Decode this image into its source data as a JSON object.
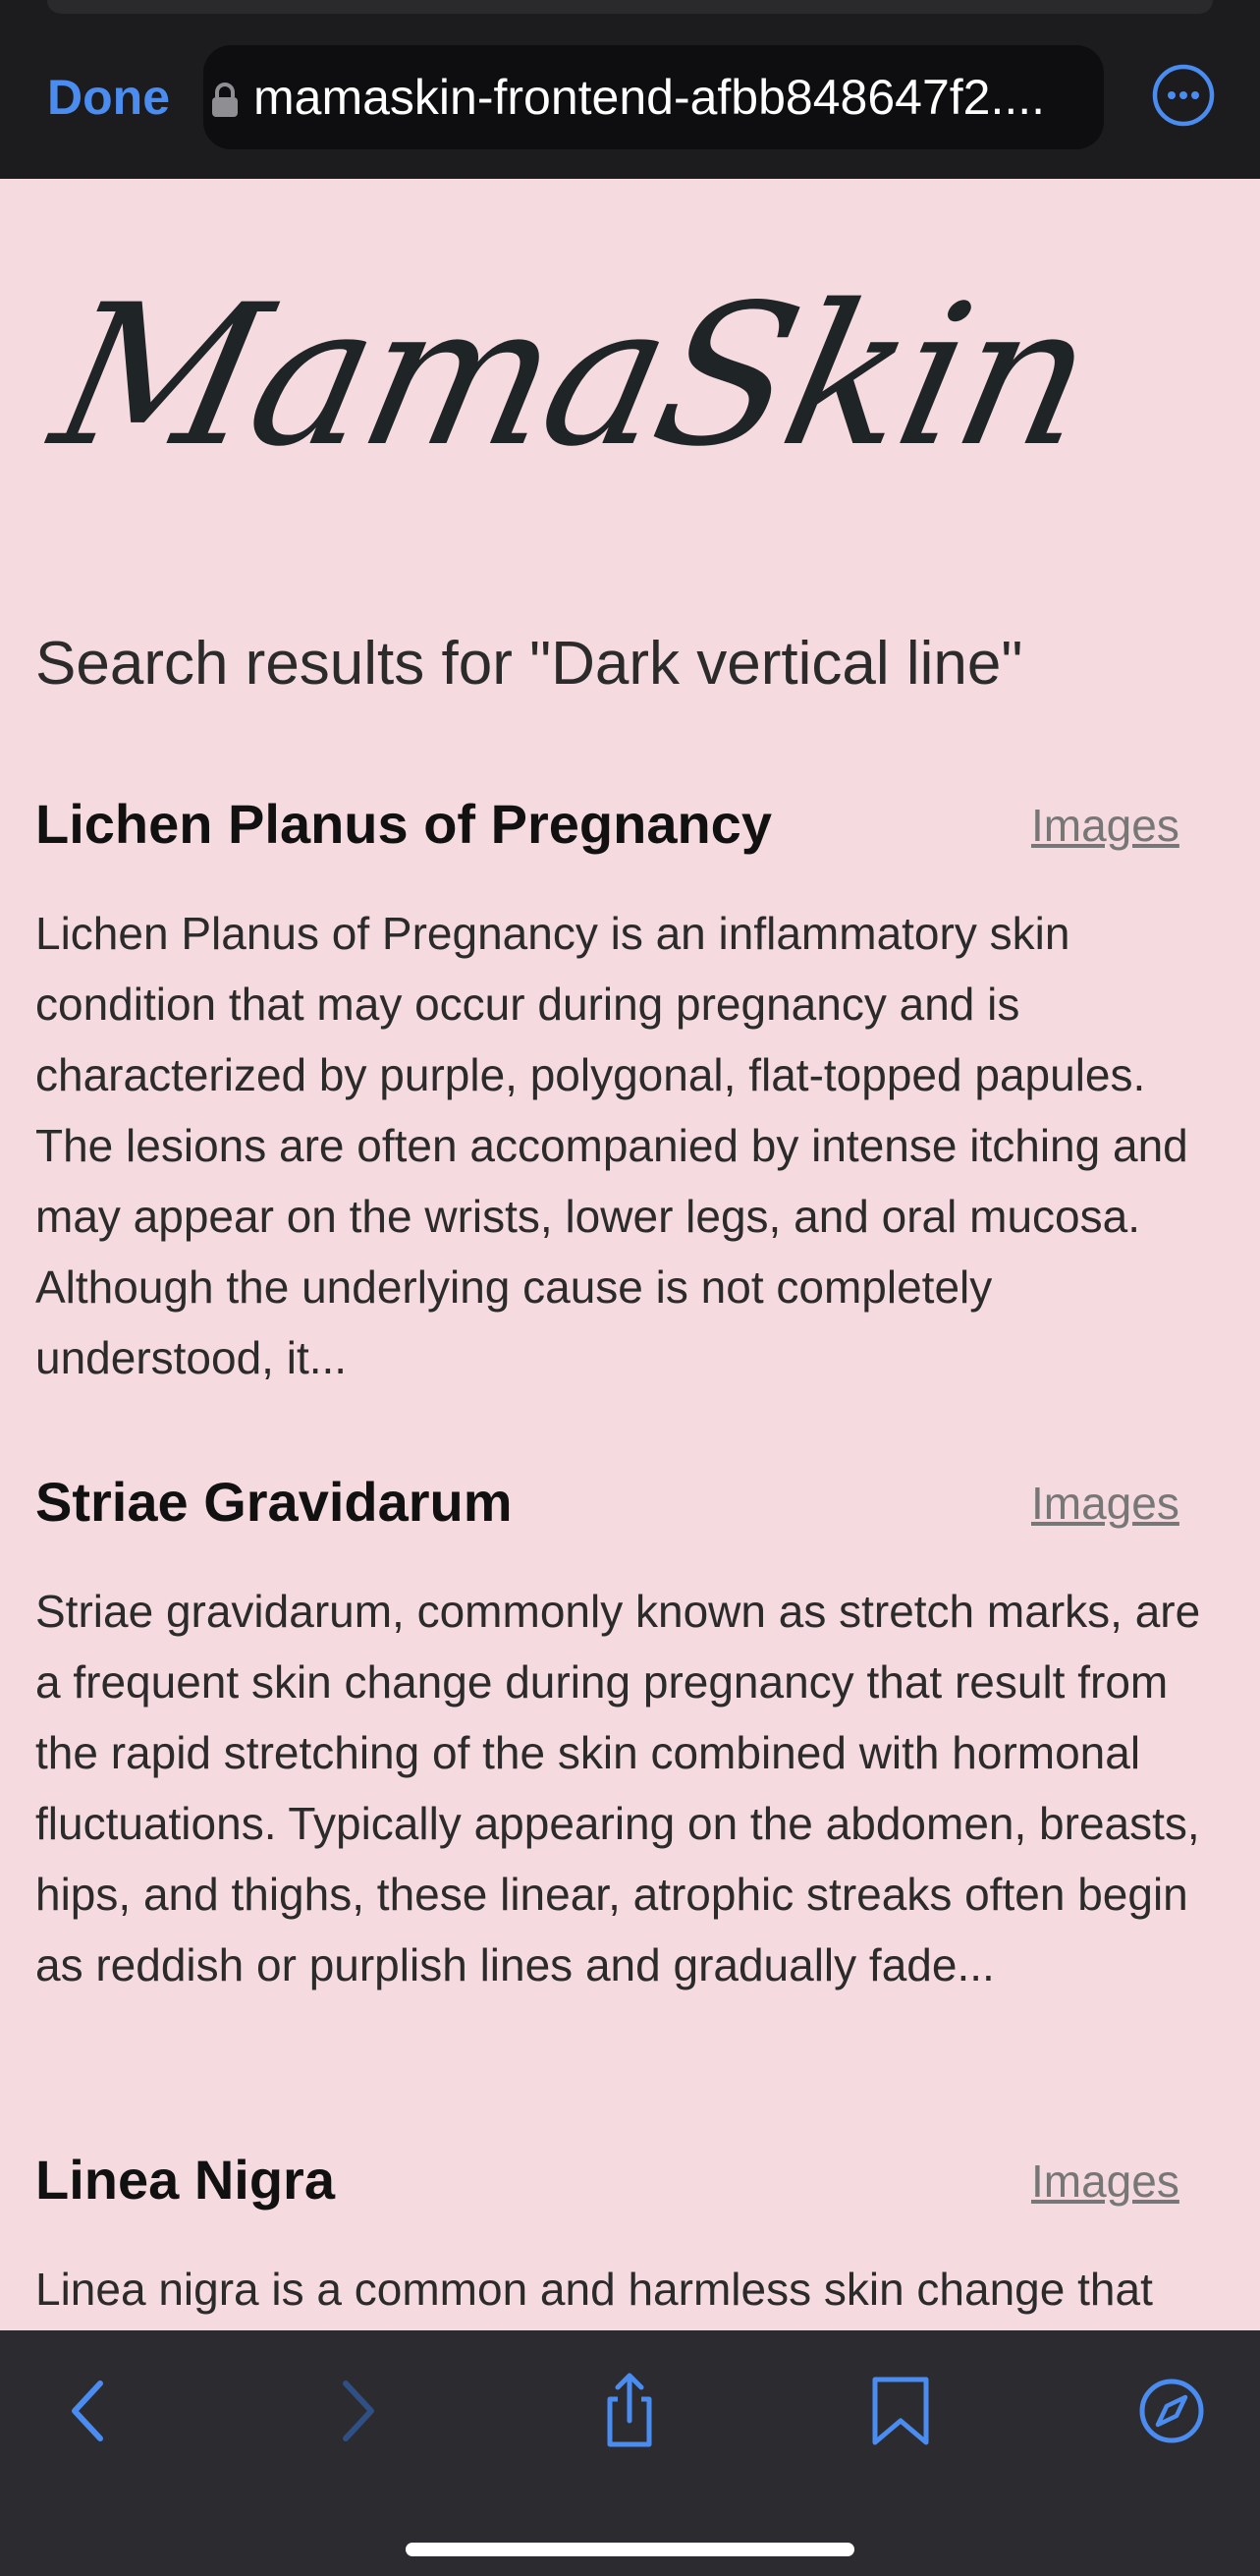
{
  "browser": {
    "done_label": "Done",
    "url": "mamaskin-frontend-afbb848647f2....",
    "icons": {
      "lock": "lock-icon",
      "more": "more-options-icon",
      "back": "chevron-left-icon",
      "forward": "chevron-right-icon",
      "share": "share-icon",
      "bookmarks": "bookmark-icon",
      "tabs": "compass-icon"
    },
    "accent_color": "#4a8cf0"
  },
  "page": {
    "logo": "MamaSkin",
    "search_heading": "Search results for \"Dark vertical line\"",
    "background_color": "#f5dadf",
    "results": [
      {
        "title": "Lichen Planus of Pregnancy",
        "images_label": "Images",
        "description": "Lichen Planus of Pregnancy is an inflammatory skin condition that may occur during pregnancy and is characterized by purple, polygonal, flat-topped papules. The lesions are often accompanied by intense itching and may appear on the wrists, lower legs, and oral mucosa. Although the underlying cause is not completely understood, it..."
      },
      {
        "title": "Striae Gravidarum",
        "images_label": "Images",
        "description": "Striae gravidarum, commonly known as stretch marks, are a frequent skin change during pregnancy that result from the rapid stretching of the skin combined with hormonal fluctuations. Typically appearing on the abdomen, breasts, hips, and thighs, these linear, atrophic streaks often begin as reddish or purplish lines and gradually fade..."
      },
      {
        "title": "Linea Nigra",
        "images_label": "Images",
        "description": "Linea nigra is a common and harmless skin change that"
      }
    ]
  }
}
